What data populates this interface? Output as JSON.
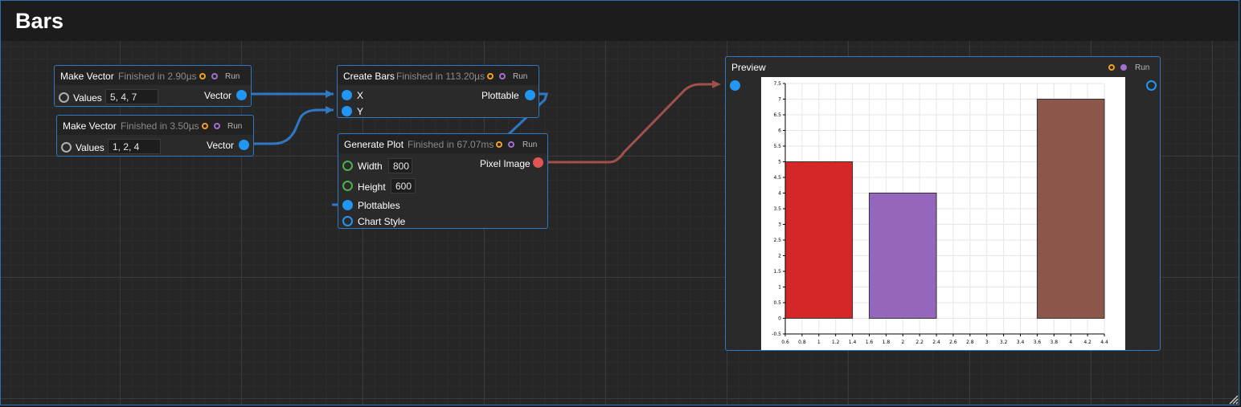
{
  "window": {
    "title": "Bars"
  },
  "nodes": {
    "make_vector_1": {
      "title": "Make Vector",
      "status": "Finished in 2.90µs",
      "run": "Run",
      "input_label": "Values",
      "input_value": "5, 4, 7",
      "output_label": "Vector"
    },
    "make_vector_2": {
      "title": "Make Vector",
      "status": "Finished in 3.50µs",
      "run": "Run",
      "input_label": "Values",
      "input_value": "1, 2, 4",
      "output_label": "Vector"
    },
    "create_bars": {
      "title": "Create Bars",
      "status": "Finished in 113.20µs",
      "run": "Run",
      "input_x": "X",
      "input_y": "Y",
      "output_label": "Plottable"
    },
    "generate_plot": {
      "title": "Generate Plot",
      "status": "Finished in 67.07ms",
      "run": "Run",
      "width_label": "Width",
      "width_value": "800",
      "height_label": "Height",
      "height_value": "600",
      "plottables_label": "Plottables",
      "chart_style_label": "Chart Style",
      "output_label": "Pixel Image"
    },
    "preview": {
      "title": "Preview",
      "run": "Run"
    }
  },
  "colors": {
    "node_border": "#2f78c4",
    "port_blue": "#2196f3",
    "port_red": "#e05555",
    "wire_blue": "#2f78c4",
    "wire_red": "#a0524a"
  },
  "icons": {
    "status": "orange-ring-icon",
    "run": "purple-ring-icon",
    "resize": "resize-grip-icon"
  },
  "chart_data": {
    "type": "bar",
    "x": [
      1,
      2,
      4
    ],
    "values": [
      5,
      4,
      7
    ],
    "bar_colors": [
      "#d62728",
      "#9467bd",
      "#8c564b"
    ],
    "xlim": [
      0.6,
      4.4
    ],
    "ylim": [
      -0.5,
      7.5
    ],
    "xticks": [
      "0.6",
      "0.8",
      "1",
      "1.2",
      "1.4",
      "1.6",
      "1.8",
      "2",
      "2.2",
      "2.4",
      "2.6",
      "2.8",
      "3",
      "3.2",
      "3.4",
      "3.6",
      "3.8",
      "4",
      "4.2",
      "4.4"
    ],
    "yticks": [
      "-0.5",
      "0",
      "0.5",
      "1",
      "1.5",
      "2",
      "2.5",
      "3",
      "3.5",
      "4",
      "4.5",
      "5",
      "5.5",
      "6",
      "6.5",
      "7",
      "7.5"
    ],
    "grid": true
  }
}
